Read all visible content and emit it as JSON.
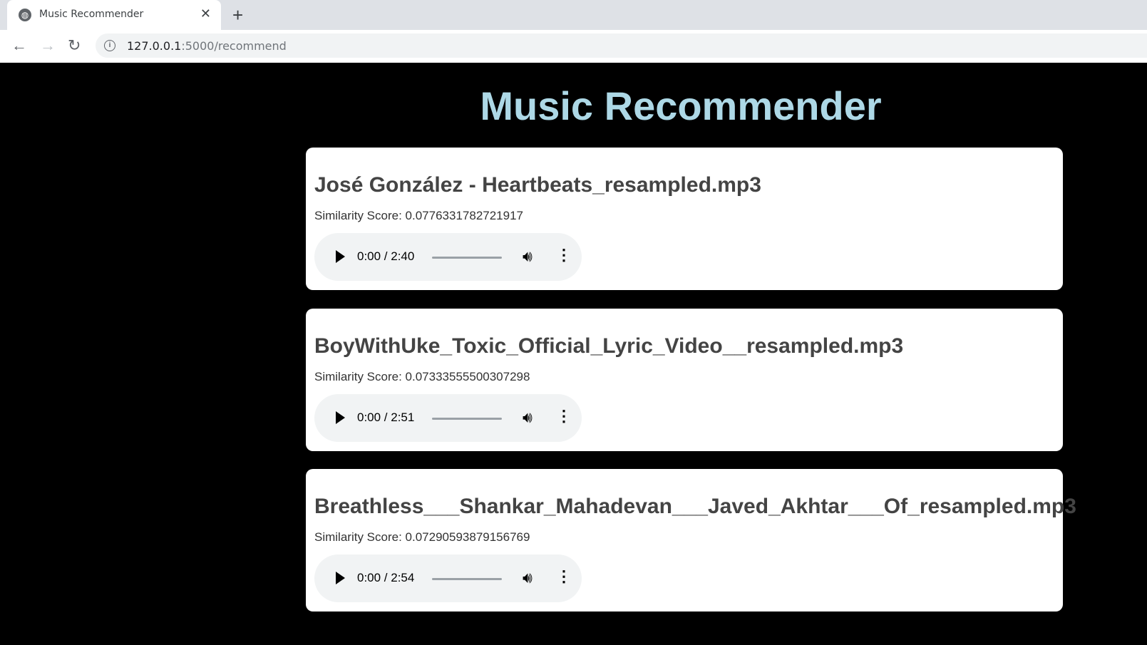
{
  "browser": {
    "tab_title": "Music Recommender",
    "url_host": "127.0.0.1",
    "url_rest": ":5000/recommend",
    "icons": {
      "favicon": "globe-icon",
      "close": "close-icon",
      "new_tab": "plus-icon",
      "back": "back-arrow-icon",
      "forward": "forward-arrow-icon",
      "reload": "reload-icon",
      "info": "info-icon"
    }
  },
  "page": {
    "heading": "Music Recommender",
    "score_label": "Similarity Score:",
    "songs": [
      {
        "title": "José González - Heartbeats_resampled.mp3",
        "score": "0.0776331782721917",
        "time": "0:00 / 2:40"
      },
      {
        "title": "BoyWithUke_Toxic_Official_Lyric_Video__resampled.mp3",
        "score": "0.07333555500307298",
        "time": "0:00 / 2:51"
      },
      {
        "title": "Breathless___Shankar_Mahadevan___Javed_Akhtar___Of_resampled.mp3",
        "score": "0.07290593879156769",
        "time": "0:00 / 2:54"
      }
    ]
  },
  "colors": {
    "background": "#000000",
    "heading": "#add8e6",
    "card": "#ffffff",
    "player": "#f1f3f4"
  }
}
